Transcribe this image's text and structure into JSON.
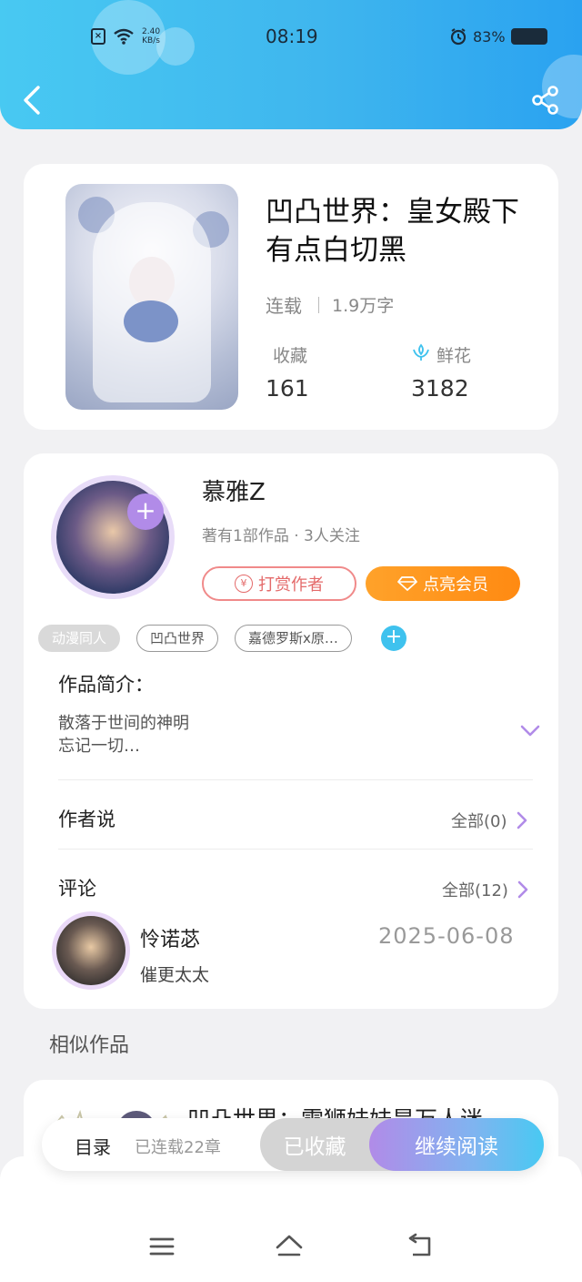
{
  "status_bar": {
    "time": "08:19",
    "net_speed_value": "2.40",
    "net_speed_unit": "KB/s",
    "battery": "83%"
  },
  "header": {
    "back_icon": "chevron-left-icon",
    "share_icon": "share-icon"
  },
  "book": {
    "title": "凹凸世界：皇女殿下有点白切黑",
    "status": "连载",
    "word_count": "1.9万字",
    "favorites_label": "收藏",
    "favorites_value": "161",
    "flowers_label": "鲜花",
    "flowers_value": "3182"
  },
  "author": {
    "name": "慕雅Z",
    "subtitle": "著有1部作品 · 3人关注",
    "tip_button": "打赏作者",
    "vip_button": "点亮会员",
    "tip_icon": "¥"
  },
  "tags": [
    "动漫同人",
    "凹凸世界",
    "嘉德罗斯x原…"
  ],
  "intro": {
    "label": "作品简介：",
    "line1": "散落于世间的神明",
    "line2": "忘记一切…"
  },
  "author_says": {
    "label": "作者说",
    "link": "全部(0)"
  },
  "comments": {
    "label": "评论",
    "link": "全部(12)",
    "items": [
      {
        "user": "怜诺苾",
        "date": "2025-06-08",
        "text": "催更太太"
      }
    ]
  },
  "similar": {
    "label": "相似作品",
    "items": [
      {
        "title": "凹凸世界：雷狮妹妹是万人迷"
      }
    ]
  },
  "action_bar": {
    "toc": "目录",
    "chapters": "已连载22章",
    "favorited": "已收藏",
    "continue": "继续阅读"
  },
  "colors": {
    "accent_blue": "#3fb6ee",
    "accent_purple": "#b18be8",
    "vip_orange": "#ff8a12",
    "tip_red": "#e46a6a"
  }
}
